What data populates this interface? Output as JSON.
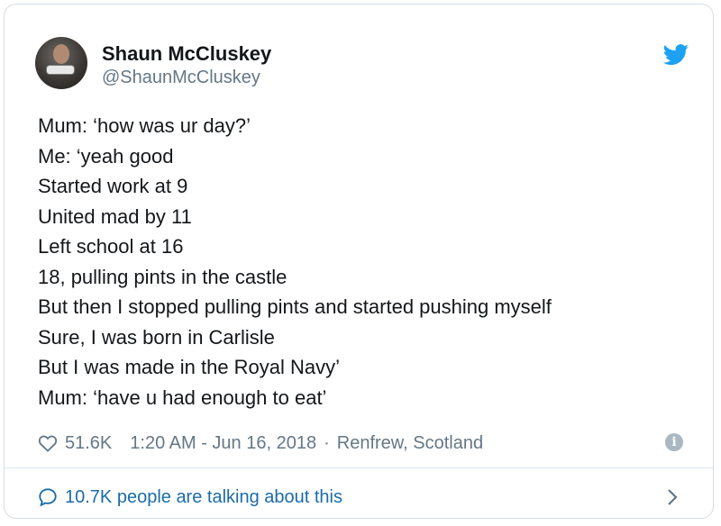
{
  "author": {
    "name": "Shaun McCluskey",
    "handle": "@ShaunMcCluskey"
  },
  "tweet": {
    "lines": [
      "Mum: ‘how was ur day?’",
      "Me: ‘yeah good",
      "Started work at 9",
      "United mad by 11",
      "Left school at 16",
      "18, pulling pints in the castle",
      "But then I stopped pulling pints and started pushing myself",
      "Sure, I was born in Carlisle",
      "But I was made in the Royal Navy’",
      "Mum: ‘have u had enough to eat’"
    ]
  },
  "meta": {
    "likes": "51.6K",
    "time": "1:20 AM - Jun 16, 2018",
    "separator": "·",
    "location": "Renfrew, Scotland"
  },
  "footer": {
    "talking": "10.7K people are talking about this"
  },
  "icons": {
    "brand": "twitter-bird-icon",
    "like": "heart-icon",
    "info": "info-icon",
    "reply": "speech-bubble-icon",
    "expand": "chevron-right-icon"
  },
  "colors": {
    "brand": "#1da1f2",
    "text": "#14171a",
    "secondary": "#657786",
    "link": "#1b6ca8",
    "border": "#d6dce1"
  }
}
